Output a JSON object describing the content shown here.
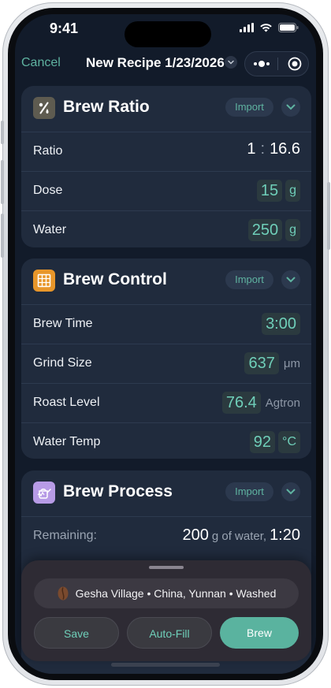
{
  "status": {
    "time": "9:41"
  },
  "nav": {
    "cancel_label": "Cancel",
    "title": "New Recipe 1/23/2026"
  },
  "colors": {
    "accent": "#5fb3a1",
    "value": "#6fcfb9",
    "background": "#121b2a",
    "card": "#202b3d"
  },
  "brew_ratio": {
    "title": "Brew Ratio",
    "icon": "percent-icon",
    "import_label": "Import",
    "rows": [
      {
        "label": "Ratio",
        "left": "1",
        "separator": ":",
        "right": "16.6"
      },
      {
        "label": "Dose",
        "value": "15",
        "unit": "g"
      },
      {
        "label": "Water",
        "value": "250",
        "unit": "g"
      }
    ]
  },
  "brew_control": {
    "title": "Brew Control",
    "icon": "grid-icon",
    "import_label": "Import",
    "rows": [
      {
        "label": "Brew Time",
        "value": "3:00",
        "unit": ""
      },
      {
        "label": "Grind Size",
        "value": "637",
        "unit": "μm"
      },
      {
        "label": "Roast Level",
        "value": "76.4",
        "unit": "Agtron"
      },
      {
        "label": "Water Temp",
        "value": "92",
        "unit": "°C"
      }
    ]
  },
  "brew_process": {
    "title": "Brew Process",
    "icon": "kettle-icon",
    "import_label": "Import",
    "remaining_label": "Remaining:",
    "remaining_amount": "200",
    "remaining_unit": "g of water,",
    "remaining_time": "1:20"
  },
  "bottom_sheet": {
    "bean": "Gesha Village • China, Yunnan • Washed",
    "save_label": "Save",
    "autofill_label": "Auto-Fill",
    "brew_label": "Brew"
  }
}
